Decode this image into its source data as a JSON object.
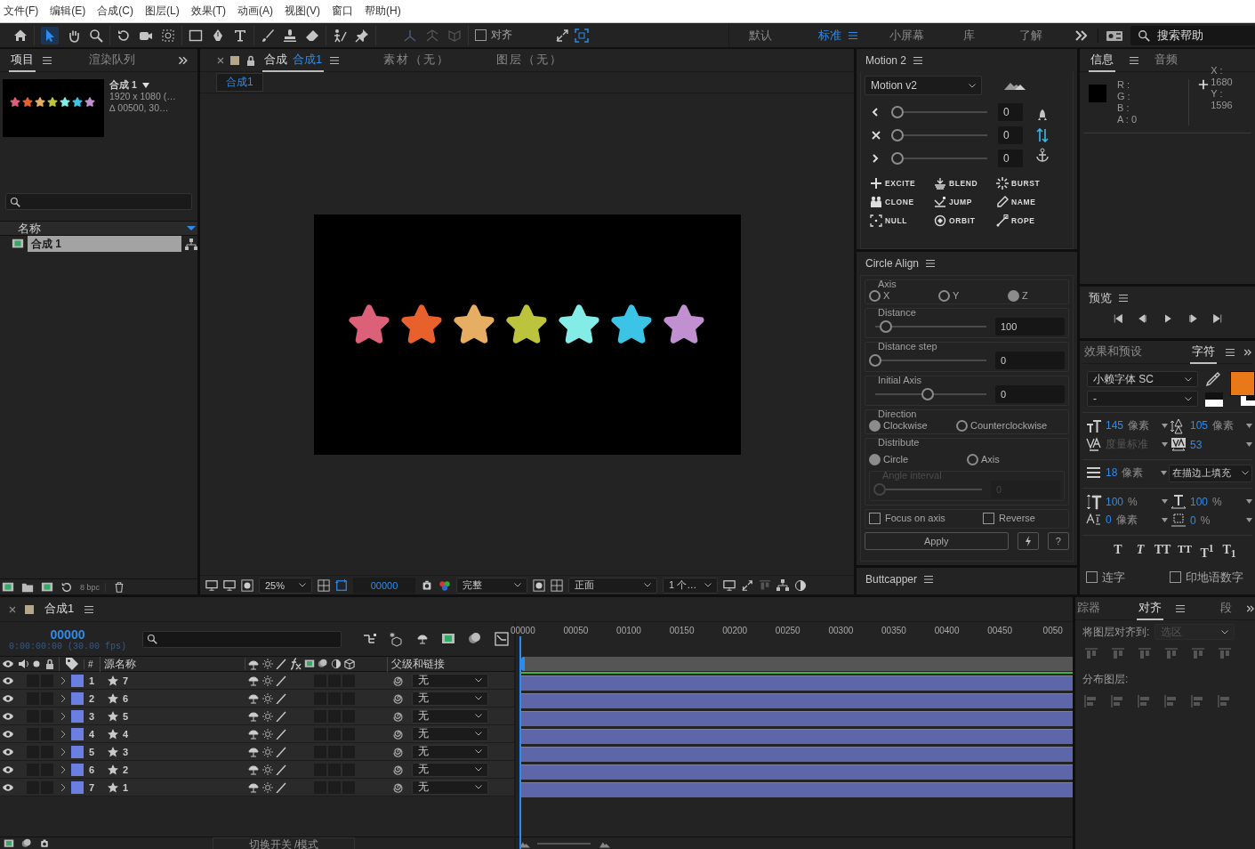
{
  "menu": [
    "文件(F)",
    "编辑(E)",
    "合成(C)",
    "图层(L)",
    "效果(T)",
    "动画(A)",
    "视图(V)",
    "窗口",
    "帮助(H)"
  ],
  "toolbar": {
    "snap": {
      "label": "对齐",
      "checked": false
    }
  },
  "workspaces": [
    {
      "label": "默认",
      "selected": false
    },
    {
      "label": "标准",
      "selected": true
    },
    {
      "label": "小屏幕",
      "selected": false
    },
    {
      "label": "库",
      "selected": false
    },
    {
      "label": "了解",
      "selected": false
    }
  ],
  "help_search": {
    "placeholder": "搜索帮助"
  },
  "project": {
    "tabs": [
      {
        "label": "项目",
        "selected": true
      },
      {
        "label": "渲染队列",
        "selected": false
      }
    ],
    "preview": {
      "name": "合成 1",
      "size": "1920 x 1080 (…",
      "duration": "∆ 00500, 30…"
    },
    "column": "名称",
    "items": [
      {
        "name": "合成 1",
        "selected": true
      }
    ],
    "bpc": "8 bpc"
  },
  "viewer": {
    "tabs": [
      {
        "kind": "comp",
        "prefix": "合成",
        "label": "合成1",
        "selected": true
      },
      {
        "kind": "plain",
        "label": "素材（无）",
        "selected": false
      },
      {
        "kind": "plain",
        "label": "图层（无）",
        "selected": false
      }
    ],
    "breadcrumb": "合成1",
    "stars": [
      {
        "color": "#dc6078"
      },
      {
        "color": "#e8602c"
      },
      {
        "color": "#e6ae62"
      },
      {
        "color": "#bcc43e"
      },
      {
        "color": "#84ece6"
      },
      {
        "color": "#3cc4e6"
      },
      {
        "color": "#c090d0"
      }
    ],
    "zoom": "25%",
    "timecode": "00000",
    "resolution": "完整",
    "view": "正面",
    "views": "1 个…"
  },
  "motion": {
    "title": "Motion 2",
    "preset": "Motion v2",
    "sliders": [
      {
        "level": 0,
        "value": "0"
      },
      {
        "level": 0,
        "value": "0"
      },
      {
        "level": 0,
        "value": "0"
      }
    ],
    "actions": [
      "EXCITE",
      "BLEND",
      "BURST",
      "CLONE",
      "JUMP",
      "NAME",
      "NULL",
      "ORBIT",
      "ROPE"
    ]
  },
  "circle_align": {
    "title": "Circle Align",
    "axis": {
      "label": "Axis",
      "options": [
        {
          "label": "X",
          "selected": false
        },
        {
          "label": "Y",
          "selected": false
        },
        {
          "label": "Z",
          "selected": true
        }
      ]
    },
    "sliders": [
      {
        "label": "Distance",
        "level": 0.1,
        "value": "100"
      },
      {
        "label": "Distance step",
        "level": 0,
        "value": "0"
      },
      {
        "label": "Initial Axis",
        "level": 0.5,
        "value": "0"
      }
    ],
    "direction": {
      "label": "Direction",
      "options": [
        {
          "label": "Clockwise",
          "selected": true
        },
        {
          "label": "Counterclockwise",
          "selected": false
        }
      ]
    },
    "distribute": {
      "label": "Distribute",
      "options": [
        {
          "label": "Circle",
          "selected": true
        },
        {
          "label": "Axis",
          "selected": false
        }
      ]
    },
    "angle_interval": {
      "label": "Angle interval",
      "level": 0,
      "value": "0",
      "disabled": true
    },
    "checkboxes": [
      {
        "label": "Focus on axis",
        "checked": false
      },
      {
        "label": "Reverse",
        "checked": false
      }
    ],
    "apply": "Apply",
    "help": "?"
  },
  "buttcapper": {
    "title": "Buttcapper"
  },
  "info": {
    "tabs": [
      {
        "label": "信息",
        "selected": true
      },
      {
        "label": "音频",
        "selected": false
      }
    ],
    "channels": [
      "R :",
      "G :",
      "B :",
      "A :  0"
    ],
    "coords": [
      "X : 1680",
      "Y :  1596"
    ]
  },
  "preview": {
    "title": "预览"
  },
  "character": {
    "tabs": [
      {
        "label": "效果和预设",
        "selected": false
      },
      {
        "label": "字符",
        "selected": true
      }
    ],
    "font": "小赖字体 SC",
    "style": "-",
    "rows": [
      {
        "left": {
          "value": "145",
          "unit": "像素",
          "disabled": false
        },
        "right": {
          "value": "105",
          "unit": "像素",
          "disabled": false
        }
      },
      {
        "left": {
          "value": "度量标准",
          "disabled": true
        },
        "right": {
          "value": "53",
          "disabled": false
        }
      }
    ],
    "stroke": {
      "value": "18",
      "unit": "像素",
      "mode": "在描边上填充"
    },
    "rows2": [
      {
        "left": {
          "value": "100",
          "unit": "%",
          "disabled": false
        },
        "right": {
          "value": "100",
          "unit": "%",
          "disabled": false
        }
      },
      {
        "left": {
          "value": "0",
          "unit": "像素",
          "disabled": false
        },
        "right": {
          "value": "0",
          "unit": "%",
          "disabled": false
        }
      }
    ],
    "styles": [
      "T",
      "T",
      "TT",
      "TT",
      "T$^{1}$",
      "T$_{1}$"
    ],
    "options": [
      {
        "label": "连字",
        "checked": false
      },
      {
        "label": "印地语数字",
        "checked": false
      }
    ]
  },
  "timeline": {
    "tab": "合成1",
    "timecode": "00000",
    "timecode_sub": "0:00:00:00 (30.00 fps)",
    "columns": {
      "index": "#",
      "name": "源名称",
      "parent": "父级和链接"
    },
    "layers": [
      {
        "index": "1",
        "name": "7",
        "parent": "无",
        "visible": true
      },
      {
        "index": "2",
        "name": "6",
        "parent": "无",
        "visible": true
      },
      {
        "index": "3",
        "name": "5",
        "parent": "无",
        "visible": true
      },
      {
        "index": "4",
        "name": "4",
        "parent": "无",
        "visible": true
      },
      {
        "index": "5",
        "name": "3",
        "parent": "无",
        "visible": true
      },
      {
        "index": "6",
        "name": "2",
        "parent": "无",
        "visible": true
      },
      {
        "index": "7",
        "name": "1",
        "parent": "无",
        "visible": true
      }
    ],
    "ruler": [
      "00000",
      "00050",
      "00100",
      "00150",
      "00200",
      "00250",
      "00300",
      "00350",
      "00400",
      "00450",
      "0050"
    ],
    "footer": "切换开关 /模式"
  },
  "align": {
    "tabs": [
      {
        "label": "踪器",
        "selected": false
      },
      {
        "label": "对齐",
        "selected": true
      },
      {
        "label": "段",
        "selected": false
      }
    ],
    "align_to": "将图层对齐到:",
    "target": "选区",
    "distribute": "分布图层:"
  }
}
